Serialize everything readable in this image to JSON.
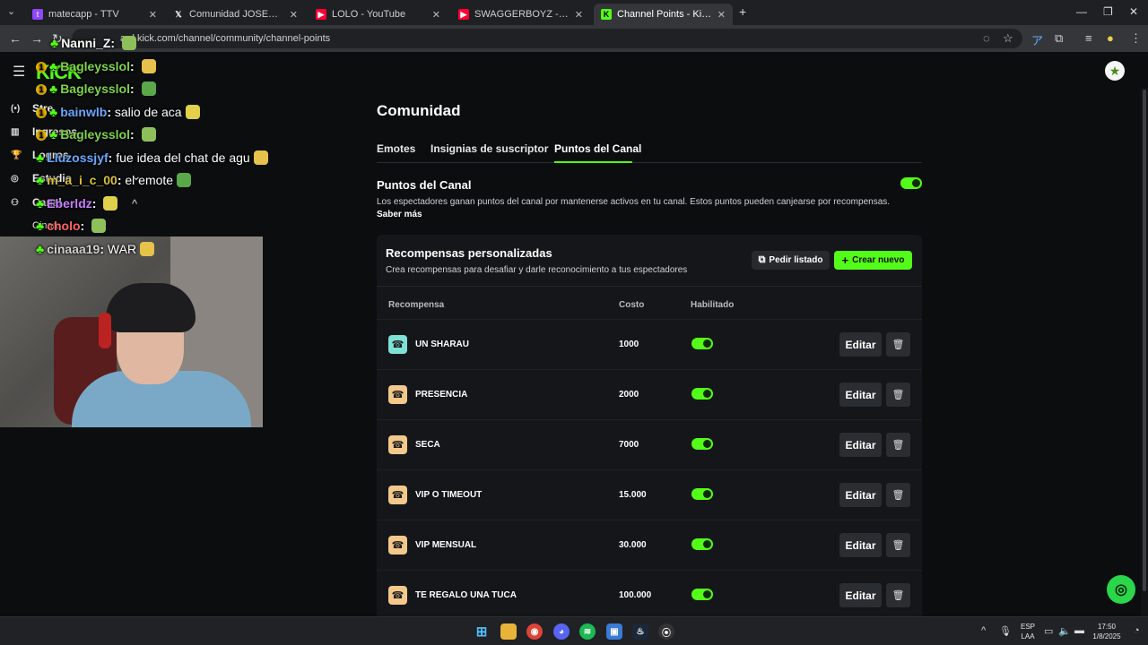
{
  "browser": {
    "tabs": [
      {
        "title": "matecapp - TTV",
        "favicon_color": "#9146ff"
      },
      {
        "title": "Comunidad JOSEO EXCLUSIVE",
        "favicon_color": "#ffffff"
      },
      {
        "title": "LOLO - YouTube",
        "favicon_color": "#ff0033"
      },
      {
        "title": "SWAGGERBOYZ - CUANDO QU",
        "favicon_color": "#ff0033"
      },
      {
        "title": "Channel Points - Kick Dashboa",
        "favicon_color": "#53fc18"
      }
    ],
    "tab_close": "✕",
    "new_tab": "+",
    "url": "ard.kick.com/channel/community/channel-points"
  },
  "kick": {
    "logo": "KICK",
    "sidebar": [
      {
        "label": "Stre",
        "icon": "(•)"
      },
      {
        "label": "Ingresos",
        "icon": "▥"
      },
      {
        "label": "Logros",
        "icon": "🏆"
      },
      {
        "label": "Estudio",
        "icon": "◎"
      },
      {
        "label": "Canal",
        "icon": "⚇"
      },
      {
        "label": "Cinaa",
        "icon": ""
      }
    ],
    "sidebar_chevrons": {
      "down": "⌄",
      "up": "^"
    }
  },
  "chat": [
    {
      "user": "Nanni_Z",
      "text": "",
      "badge": false,
      "color": "#ffffff"
    },
    {
      "user": "Bagleysslol",
      "text": "",
      "badge": true,
      "color": "#7fd34a"
    },
    {
      "user": "Bagleysslol",
      "text": "",
      "badge": true,
      "color": "#7fd34a"
    },
    {
      "user": "bainwlb",
      "text": "salio de aca",
      "badge": true,
      "color": "#6aa8ff"
    },
    {
      "user": "Bagleysslol",
      "text": "",
      "badge": true,
      "color": "#7fd34a"
    },
    {
      "user": "Lluzossjyf",
      "text": "fue idea del chat de agu",
      "badge": false,
      "color": "#6aa8ff"
    },
    {
      "user": "m_a_i_c_00",
      "text": "el emote",
      "badge": false,
      "color": "#d8c040"
    },
    {
      "user": "Eberldz",
      "text": "",
      "badge": false,
      "color": "#c77dff"
    },
    {
      "user": "cholo",
      "text": "",
      "badge": false,
      "color": "#ff6464"
    },
    {
      "user": "cinaaa19",
      "text": "WAR",
      "badge": false,
      "color": "#cfcfcf"
    }
  ],
  "page": {
    "title": "Comunidad",
    "tabs": [
      "Emotes",
      "Insignias de suscriptor",
      "Puntos del Canal"
    ],
    "section_title": "Puntos del Canal",
    "section_desc": "Los espectadores ganan puntos del canal por mantenerse activos en tu canal. Estos puntos pueden canjearse por recompensas.",
    "learn_more": "Saber más",
    "card": {
      "title": "Recompensas personalizadas",
      "subtitle": "Crea recompensas para desafiar y darle reconocimiento a tus espectadores",
      "request_btn": "Pedir listado",
      "create_btn": "Crear nuevo",
      "columns": [
        "Recompensa",
        "Costo",
        "Habilitado"
      ],
      "edit_label": "Editar",
      "rows": [
        {
          "name": "UN SHARAU",
          "cost": "1000",
          "enabled": true,
          "color": "#7fe0d6"
        },
        {
          "name": "PRESENCIA",
          "cost": "2000",
          "enabled": true,
          "color": "#f2c98a"
        },
        {
          "name": "SECA",
          "cost": "7000",
          "enabled": true,
          "color": "#f2c98a"
        },
        {
          "name": "VIP O TIMEOUT",
          "cost": "15.000",
          "enabled": true,
          "color": "#f2c98a"
        },
        {
          "name": "VIP MENSUAL",
          "cost": "30.000",
          "enabled": true,
          "color": "#f2c98a"
        },
        {
          "name": "TE REGALO UNA TUCA",
          "cost": "100.000",
          "enabled": true,
          "color": "#f2c98a"
        }
      ]
    }
  },
  "taskbar": {
    "lang": "ESP",
    "layout": "LAA",
    "time": "17:50",
    "date": "1/8/2025"
  },
  "colors": {
    "accent": "#53fc18"
  }
}
